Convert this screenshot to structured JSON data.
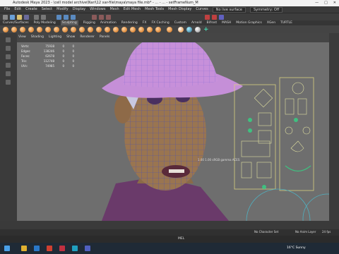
{
  "window": {
    "title": "Autodesk Maya 2023 - \\cell model archive\\Nari\\12 xar-file\\maya\\maya file.mb* - ... - ... - setFrameNum_M"
  },
  "menubar": {
    "items": [
      "File",
      "Edit",
      "Create",
      "Select",
      "Modify",
      "Display",
      "Windows",
      "Mesh",
      "Edit Mesh",
      "Mesh Tools",
      "Mesh Display",
      "Curves",
      "Surfaces",
      "Deform",
      "UV",
      "Generate",
      "Cache",
      "Arnold",
      "Help"
    ],
    "no_surface": "No live surface",
    "symmetry": "Symmetry: Off"
  },
  "shelf_tabs": [
    "Curves/Surfaces",
    "Poly Modeling",
    "Sculpting",
    "Rigging",
    "Animation",
    "Rendering",
    "FX",
    "FX Caching",
    "Custom",
    "Arnold",
    "Bifrost",
    "MASH",
    "Motion Graphics",
    "XGen",
    "TURTLE",
    "Xgen",
    "XZ",
    "Dolly",
    "CoDriver",
    "Wire"
  ],
  "viewport_menu": [
    "View",
    "Shading",
    "Lighting",
    "Show",
    "Renderer",
    "Panels"
  ],
  "hud": {
    "rows": [
      {
        "k": "Verts:",
        "v": "75938",
        "a": "0",
        "b": "0"
      },
      {
        "k": "Edges:",
        "v": "138246",
        "a": "0",
        "b": "0"
      },
      {
        "k": "Faces:",
        "v": "62678",
        "a": "0",
        "b": "0"
      },
      {
        "k": "Tris:",
        "v": "112748",
        "a": "0",
        "b": "0"
      },
      {
        "k": "UVs:",
        "v": "74985",
        "a": "0",
        "b": "0"
      }
    ]
  },
  "viewport_label": "1.00  1.00  sRGB gamma  ACES",
  "range": {
    "no_char": "No Character Set",
    "no_anim": "No Anim Layer",
    "fps": "24 fps"
  },
  "cmd": {
    "mode": "MEL"
  },
  "taskbar": {
    "weather": "16°C",
    "weather_text": "Sunny",
    "date": "..."
  },
  "colors": {
    "accent": "#e09030",
    "hat": "#c58fd8",
    "skin": "#9a7550",
    "wire": "#3340c0",
    "panel": "#3b3b3b"
  }
}
